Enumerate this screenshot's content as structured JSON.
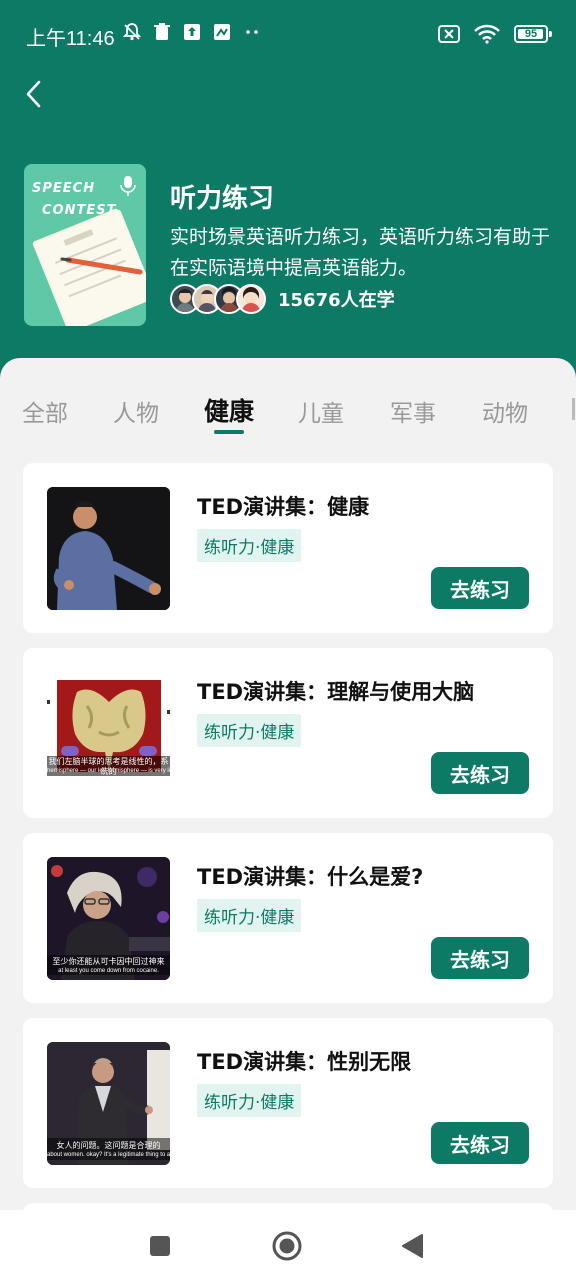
{
  "status_bar": {
    "time": "上午11:46",
    "battery": "95",
    "battery_level": 0.95
  },
  "header": {
    "cover_line1": "SPEECH",
    "cover_line2": "CONTEST",
    "title": "听力练习",
    "description": "实时场景英语听力练习，英语听力练习有助于在实际语境中提高英语能力。",
    "learner_count": "15676人在学"
  },
  "tabs": [
    {
      "label": "全部"
    },
    {
      "label": "人物"
    },
    {
      "label": "健康"
    },
    {
      "label": "儿童"
    },
    {
      "label": "军事"
    },
    {
      "label": "动物"
    }
  ],
  "active_tab": "健康",
  "cards": [
    {
      "title": "TED演讲集：健康",
      "tag": "练听力·健康",
      "button": "去练习"
    },
    {
      "title": "TED演讲集：理解与使用大脑",
      "tag": "练听力·健康",
      "button": "去练习",
      "subtitle_cn": "我们左脑半球的思考是线性的，系统的",
      "subtitle_en": "hemisphere — our left hemisphere — is very linear"
    },
    {
      "title": "TED演讲集：什么是爱?",
      "tag": "练听力·健康",
      "button": "去练习",
      "subtitle_cn": "至少你还能从可卡因中回过神来",
      "subtitle_en": "at least you come down from cocaine."
    },
    {
      "title": "TED演讲集：性别无限",
      "tag": "练听力·健康",
      "button": "去练习",
      "subtitle_cn": "女人的问题。这问题是合理的",
      "subtitle_en": "about women. okay? It's a legitimate thing to ask."
    }
  ],
  "colors": {
    "brand": "#0d7a66",
    "tag_bg": "#e2f4ef"
  }
}
